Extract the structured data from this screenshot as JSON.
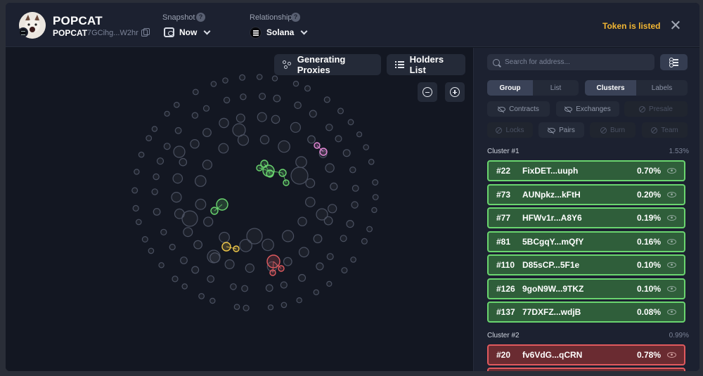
{
  "token": {
    "name": "POPCAT",
    "symbol": "POPCAT",
    "address": "7GCihg...W2hr"
  },
  "snapshot": {
    "label": "Snapshot",
    "value": "Now"
  },
  "relationship": {
    "label": "Relationship",
    "value": "Solana"
  },
  "status": "Token is listed",
  "graph": {
    "buttons": {
      "proxies": "Generating Proxies",
      "holders": "Holders List"
    }
  },
  "panel": {
    "search_placeholder": "Search for address...",
    "view_tabs": [
      "Group",
      "List"
    ],
    "mode_tabs": [
      "Clusters",
      "Labels"
    ],
    "filters_row1": [
      "Contracts",
      "Exchanges",
      "Presale"
    ],
    "filters_row2": [
      "Locks",
      "Pairs",
      "Burn",
      "Team"
    ],
    "clusters": [
      {
        "title": "Cluster #1",
        "share": "1.53%",
        "color": "#6ad56f",
        "holders": [
          {
            "rank": "#22",
            "address": "FixDET...uuph",
            "pct": "0.70%"
          },
          {
            "rank": "#73",
            "address": "AUNpkz...kFtH",
            "pct": "0.20%"
          },
          {
            "rank": "#77",
            "address": "HFWv1r...A8Y6",
            "pct": "0.19%"
          },
          {
            "rank": "#81",
            "address": "5BCgqY...mQfY",
            "pct": "0.16%"
          },
          {
            "rank": "#110",
            "address": "D85sCP...5F1e",
            "pct": "0.10%"
          },
          {
            "rank": "#126",
            "address": "9goN9W...9TKZ",
            "pct": "0.10%"
          },
          {
            "rank": "#137",
            "address": "77DXFZ...wdjB",
            "pct": "0.08%"
          }
        ]
      },
      {
        "title": "Cluster #2",
        "share": "0.99%",
        "color": "#e05a5e",
        "holders": [
          {
            "rank": "#20",
            "address": "fv6VdG...qCRN",
            "pct": "0.78%"
          }
        ]
      }
    ]
  }
}
